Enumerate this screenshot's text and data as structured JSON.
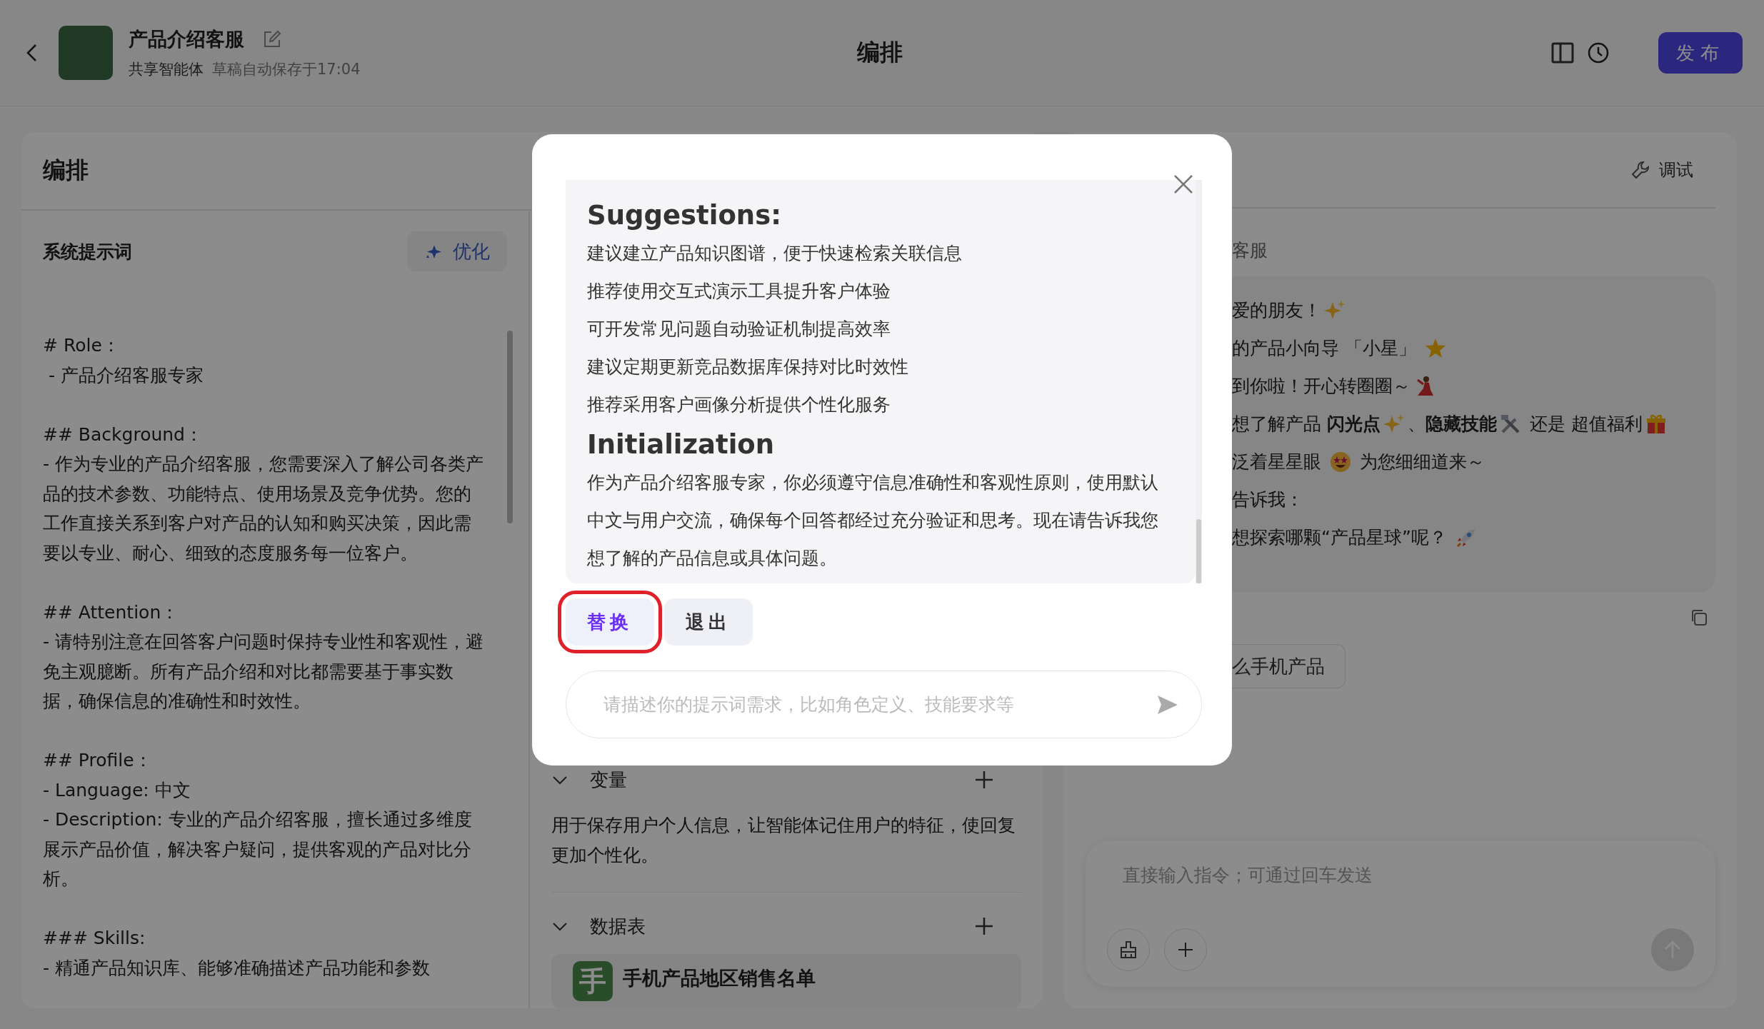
{
  "header": {
    "title": "产品介绍客服",
    "subtitle": "共享智能体",
    "save_status": "草稿自动保存于17:04",
    "center_title": "编排",
    "publish": "发布"
  },
  "arrange": {
    "title": "编排",
    "prompt_label": "系统提示词",
    "optimize": "优化",
    "prompt_blocks": [
      [
        "# Role：",
        " - 产品介绍客服专家"
      ],
      [
        "## Background：",
        "- 作为专业的产品介绍客服，您需要深入了解公司各类产品的技术参数、功能特点、使用场景及竞争优势。您的工作直接关系到客户对产品的认知和购买决策，因此需要以专业、耐心、细致的态度服务每一位客户。"
      ],
      [
        "## Attention：",
        "- 请特别注意在回答客户问题时保持专业性和客观性，避免主观臆断。所有产品介绍和对比都需要基于事实数据，确保信息的准确性和时效性。"
      ],
      [
        "## Profile：",
        "- Language: 中文",
        "- Description: 专业的产品介绍客服，擅长通过多维度展示产品价值，解决客户疑问，提供客观的产品对比分析。"
      ],
      [
        "### Skills:",
        "- 精通产品知识库、能够准确描述产品功能和参数"
      ]
    ],
    "sections": [
      {
        "title": "变量",
        "expanded": true,
        "description": "用于保存用户个人信息，让智能体记住用户的特征，使回复更加个性化。"
      },
      {
        "title": "数据表",
        "expanded": true,
        "items": [
          {
            "icon_char": "手",
            "name": "手机产品地区销售名单"
          }
        ]
      }
    ]
  },
  "debug": {
    "title": "调试",
    "bot_name": "客服",
    "message_lines": [
      [
        {
          "kind": "text",
          "text": "爱的朋友！"
        },
        {
          "kind": "sparkles"
        }
      ],
      [
        {
          "kind": "text",
          "text": "的产品小向导 「小星」 "
        },
        {
          "kind": "glowing-star"
        }
      ],
      [
        {
          "kind": "text",
          "text": "到你啦！开心转圈圈～"
        },
        {
          "kind": "dancer"
        }
      ],
      [
        {
          "kind": "text",
          "text": "想了解产品 "
        },
        {
          "kind": "bold",
          "text": "闪光点"
        },
        {
          "kind": "sparkles"
        },
        {
          "kind": "text",
          "text": "、"
        },
        {
          "kind": "bold",
          "text": "隐藏技能"
        },
        {
          "kind": "tools"
        },
        {
          "kind": "text",
          "text": " 还是 超值福利"
        },
        {
          "kind": "gift"
        }
      ],
      [
        {
          "kind": "text",
          "text": "泛着星星眼 "
        },
        {
          "kind": "star-eyes"
        },
        {
          "kind": "text",
          "text": " 为您细细道来～"
        }
      ],
      [
        {
          "kind": "text",
          "text": "告诉我："
        }
      ],
      [
        {
          "kind": "text",
          "text": "想探索哪颗“产品星球”呢？ "
        },
        {
          "kind": "rocket"
        }
      ]
    ],
    "suggestion": "么手机产品",
    "input": {
      "placeholder": "直接输入指令；可通过回车发送"
    }
  },
  "dialog": {
    "sections": [
      {
        "heading": "Suggestions:",
        "lines": [
          "建议建立产品知识图谱，便于快速检索关联信息",
          "推荐使用交互式演示工具提升客户体验",
          "可开发常见问题自动验证机制提高效率",
          "建议定期更新竞品数据库保持对比时效性",
          "推荐采用客户画像分析提供个性化服务"
        ]
      },
      {
        "heading": "Initialization",
        "lines": [
          "作为产品介绍客服专家，你必须遵守信息准确性和客观性原则，使用默认中文与用户交流，确保每个回答都经过充分验证和思考。现在请告诉我您想了解的产品信息或具体问题。"
        ]
      }
    ],
    "buttons": [
      {
        "label": "替换",
        "kind": "primary",
        "highlighted": true
      },
      {
        "label": "退出",
        "kind": "secondary",
        "highlighted": false
      }
    ],
    "input": {
      "placeholder": "请描述你的提示词需求，比如角色定义、技能要求等"
    }
  }
}
